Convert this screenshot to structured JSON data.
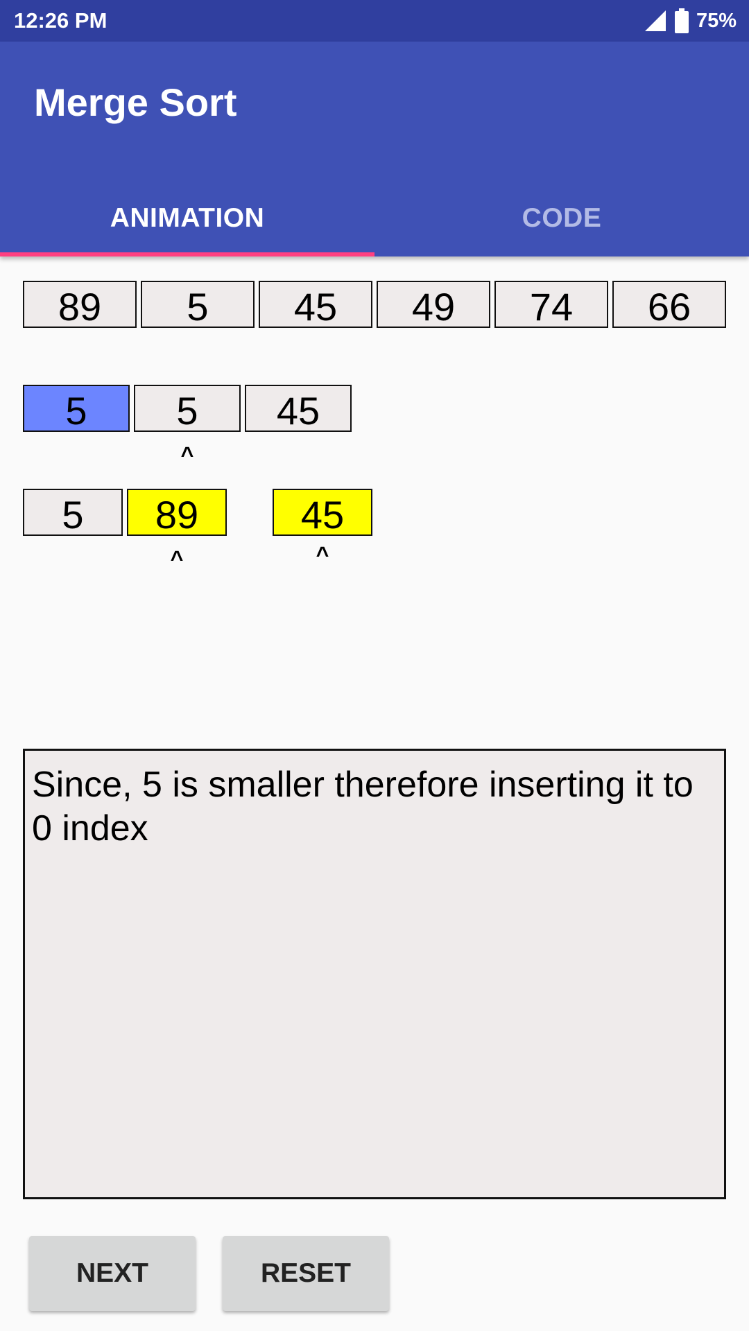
{
  "status_bar": {
    "time": "12:26 PM",
    "battery": "75%",
    "signal_icon": "cell-signal-icon",
    "battery_icon": "battery-icon"
  },
  "app": {
    "title": "Merge Sort"
  },
  "tabs": [
    {
      "label": "ANIMATION",
      "selected": true
    },
    {
      "label": "CODE",
      "selected": false
    }
  ],
  "colors": {
    "primary": "#3f51b5",
    "primary_dark": "#303f9f",
    "accent": "#ff4081",
    "highlight_blue": "#6c85ff",
    "highlight_yellow": "#ffff00",
    "cell_bg": "#efebeb"
  },
  "array_row": [
    "89",
    "5",
    "45",
    "49",
    "74",
    "66"
  ],
  "merged_row": [
    "5",
    "5",
    "45"
  ],
  "left_row": [
    "5",
    "89"
  ],
  "right_row": [
    "45"
  ],
  "pointer": "^",
  "message": "Since, 5 is smaller therefore inserting it to 0 index",
  "buttons": {
    "next": "NEXT",
    "reset": "RESET"
  }
}
